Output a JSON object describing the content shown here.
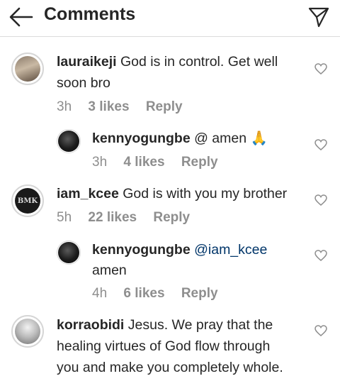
{
  "header": {
    "title": "Comments"
  },
  "comments": [
    {
      "username": "lauraikeji",
      "text": "God is in control. Get well",
      "text2": "soon bro",
      "time": "3h",
      "likes": "3 likes",
      "reply": "Reply"
    },
    {
      "username": "kennyogungbe",
      "text": "@ amen 🙏",
      "time": "3h",
      "likes": "4 likes",
      "reply": "Reply"
    },
    {
      "username": "iam_kcee",
      "text": "God is with you my brother",
      "time": "5h",
      "likes": "22 likes",
      "reply": "Reply"
    },
    {
      "username": "kennyogungbe",
      "mention": "@iam_kcee",
      "text2": "amen",
      "time": "4h",
      "likes": "6 likes",
      "reply": "Reply"
    },
    {
      "username": "korraobidi",
      "text": "Jesus. We pray that the",
      "text2": "healing virtues of God flow through",
      "text3": "you and make you completely whole."
    }
  ],
  "avatars": {
    "kcee_logo_text": "BMK"
  },
  "colors": {
    "mention": "#003569",
    "meta": "#8e8e8e",
    "divider": "#dbdbdb"
  },
  "icons": [
    "back-arrow-icon",
    "send-icon",
    "heart-icon"
  ]
}
